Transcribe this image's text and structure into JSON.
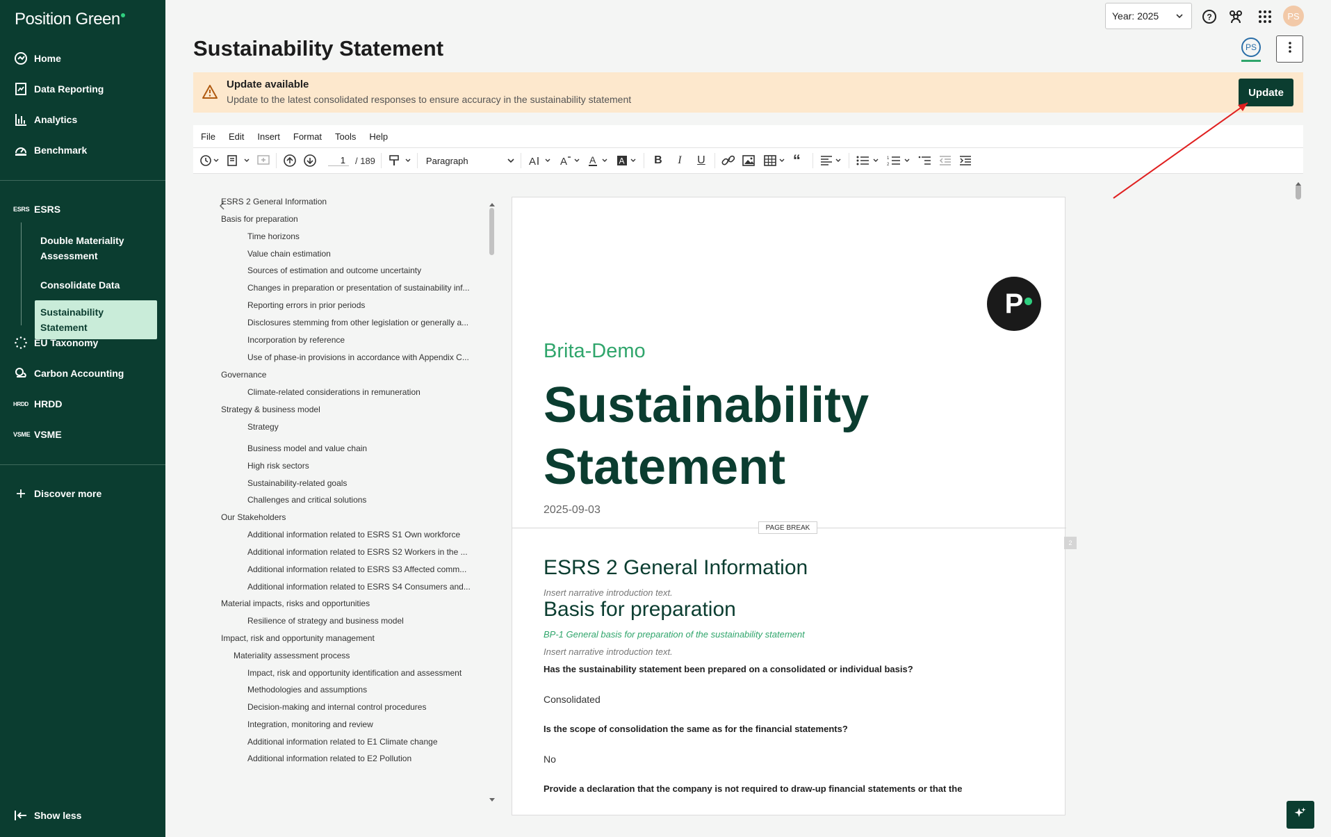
{
  "app": {
    "logo": "Position Green"
  },
  "sidebar": {
    "nav": [
      {
        "label": "Home",
        "icon": "home-icon"
      },
      {
        "label": "Data Reporting",
        "icon": "data-reporting-icon"
      },
      {
        "label": "Analytics",
        "icon": "analytics-icon"
      },
      {
        "label": "Benchmark",
        "icon": "benchmark-icon"
      }
    ],
    "esrs": {
      "tag": "ESRS",
      "label": "ESRS"
    },
    "esrs_sub": [
      {
        "label": "Double Materiality Assessment"
      },
      {
        "label": "Consolidate Data"
      },
      {
        "label": "Sustainability Statement",
        "active": true
      }
    ],
    "eu_taxonomy": "EU Taxonomy",
    "carbon": "Carbon Accounting",
    "hrdd": {
      "tag": "HRDD",
      "label": "HRDD"
    },
    "vsme": {
      "tag": "VSME",
      "label": "VSME"
    },
    "discover": "Discover more",
    "show_less": "Show less"
  },
  "topbar": {
    "year_label": "Year: 2025",
    "avatar_initials": "PS"
  },
  "header": {
    "title": "Sustainability Statement",
    "ps_badge": "PS"
  },
  "banner": {
    "title": "Update available",
    "text": "Update to the latest consolidated responses to ensure accuracy in the sustainability statement",
    "button": "Update"
  },
  "editor": {
    "menus": [
      "File",
      "Edit",
      "Insert",
      "Format",
      "Tools",
      "Help"
    ],
    "page_current": "1",
    "page_total": "/  189",
    "paragraph": "Paragraph"
  },
  "toc": [
    {
      "label": "ESRS 2 General Information",
      "level": 0
    },
    {
      "label": "Basis for preparation",
      "level": 0
    },
    {
      "label": "Time horizons",
      "level": 2
    },
    {
      "label": "Value chain estimation",
      "level": 2
    },
    {
      "label": "Sources of estimation and outcome uncertainty",
      "level": 2
    },
    {
      "label": "Changes in preparation or presentation of sustainability inf...",
      "level": 2
    },
    {
      "label": "Reporting errors in prior periods",
      "level": 2
    },
    {
      "label": "Disclosures stemming from other legislation or generally a...",
      "level": 2
    },
    {
      "label": "Incorporation by reference",
      "level": 2
    },
    {
      "label": "Use of phase-in provisions in accordance with Appendix C...",
      "level": 2
    },
    {
      "label": "Governance",
      "level": 0
    },
    {
      "label": "Climate-related considerations in remuneration",
      "level": 2
    },
    {
      "label": "Strategy & business model",
      "level": 0
    },
    {
      "label": "Strategy",
      "level": 2
    },
    {
      "label": "Business model and value chain",
      "level": 2
    },
    {
      "label": "High risk sectors",
      "level": 2
    },
    {
      "label": "Sustainability-related goals",
      "level": 2
    },
    {
      "label": "Challenges and critical solutions",
      "level": 2
    },
    {
      "label": "Our Stakeholders",
      "level": 0
    },
    {
      "label": "Additional information related to ESRS S1 Own workforce",
      "level": 2
    },
    {
      "label": "Additional information related to ESRS S2 Workers in the ...",
      "level": 2
    },
    {
      "label": "Additional information related to ESRS S3 Affected comm...",
      "level": 2
    },
    {
      "label": "Additional information related to ESRS S4 Consumers and...",
      "level": 2
    },
    {
      "label": "Material impacts, risks and opportunities",
      "level": 0
    },
    {
      "label": "Resilience of strategy and business model",
      "level": 2
    },
    {
      "label": "Impact, risk and opportunity management",
      "level": 0
    },
    {
      "label": "Materiality assessment process",
      "level": 1
    },
    {
      "label": "Impact, risk and opportunity identification and assessment",
      "level": 2
    },
    {
      "label": "Methodologies and assumptions",
      "level": 2
    },
    {
      "label": "Decision-making and internal control procedures",
      "level": 2
    },
    {
      "label": "Integration, monitoring and review",
      "level": 2
    },
    {
      "label": "Additional information related to E1 Climate change",
      "level": 2
    },
    {
      "label": "Additional information related to E2 Pollution",
      "level": 2
    }
  ],
  "document": {
    "company": "Brita-Demo",
    "title_line1": "Sustainability",
    "title_line2": "Statement",
    "date": "2025-09-03",
    "page_break": "PAGE BREAK",
    "page_num": "2",
    "h_general": "ESRS 2 General Information",
    "intro1": "Insert narrative introduction text.",
    "h_basis": "Basis for preparation",
    "bp1": "BP-1 General basis for preparation of the sustainability statement",
    "intro2": "Insert narrative introduction text.",
    "q1": "Has the sustainability statement been prepared on a consolidated or individual basis?",
    "a1": "Consolidated",
    "q2": "Is the scope of consolidation the same as for the financial statements?",
    "a2": "No",
    "q3": "Provide a declaration that the company is not required to draw-up financial statements or that the"
  },
  "colors": {
    "brand_dark": "#0b3d30",
    "brand_green": "#2fa56b",
    "banner_bg": "#fde8cd",
    "annotation_arrow": "#e02020"
  }
}
